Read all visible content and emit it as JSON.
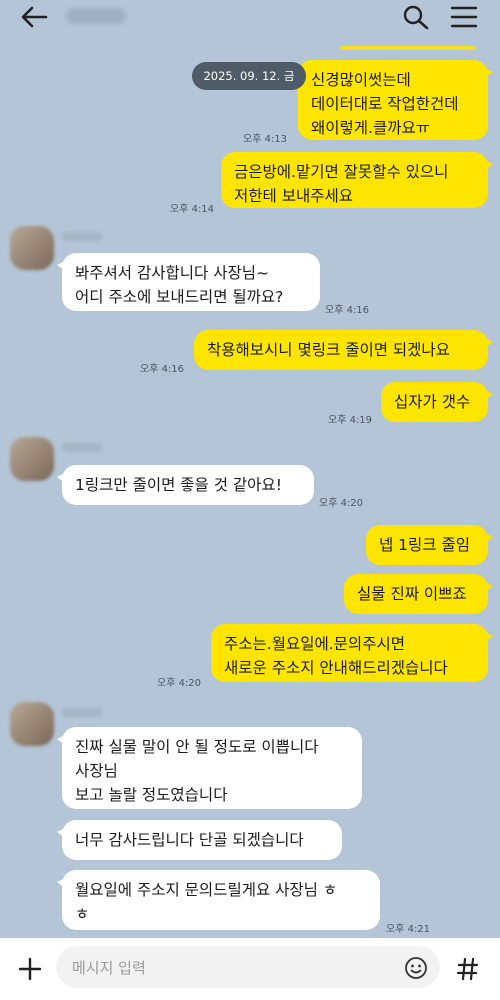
{
  "header": {
    "back_icon": "arrow-left-icon",
    "search_icon": "search-icon",
    "menu_icon": "hamburger-menu-icon"
  },
  "date_badge": "2025. 09. 12. 금",
  "messages": [
    {
      "lines": [
        "신경많이썻는데",
        "데이터대로 작업한건데",
        "왜이렇게.클까요ㅠ"
      ],
      "time": "오후 4:13"
    },
    {
      "lines": [
        "금은방에.맡기면 잘못할수 있으니",
        "저한테 보내주세요"
      ],
      "time": "오후 4:14"
    },
    {
      "lines": [
        "봐주셔서 감사합니다 사장님~",
        "어디 주소에 보내드리면 될까요?"
      ],
      "time": "오후 4:16"
    },
    {
      "lines": [
        "착용해보시니 몇링크 줄이면 되겠나요"
      ],
      "time": "오후 4:16"
    },
    {
      "lines": [
        "십자가 갯수"
      ],
      "time": "오후 4:19"
    },
    {
      "lines": [
        "1링크만 줄이면 좋을 것 같아요!"
      ],
      "time": "오후 4:20"
    },
    {
      "lines": [
        "넵 1링크 줄임"
      ]
    },
    {
      "lines": [
        "실물 진짜 이쁘죠"
      ]
    },
    {
      "lines": [
        "주소는.월요일에.문의주시면",
        "새로운 주소지 안내해드리겠습니다"
      ],
      "time": "오후 4:20"
    },
    {
      "lines": [
        "진짜 실물 말이 안 될 정도로 이쁩니다",
        "사장님",
        "보고 놀랄 정도였습니다"
      ]
    },
    {
      "lines": [
        "너무 감사드립니다 단골 되겠습니다"
      ]
    },
    {
      "lines": [
        "월요일에 주소지 문의드릴게요 사장님 ㅎ",
        "ㅎ"
      ],
      "time": "오후 4:21"
    }
  ],
  "composer": {
    "placeholder": "메시지 입력",
    "plus_icon": "plus-icon",
    "emoji_icon": "emoji-icon",
    "hash_icon": "hash-icon"
  },
  "colors": {
    "background": "#b3c5d6",
    "my_bubble": "#fee500",
    "other_bubble": "#ffffff",
    "date_pill": "#4f5b66"
  }
}
